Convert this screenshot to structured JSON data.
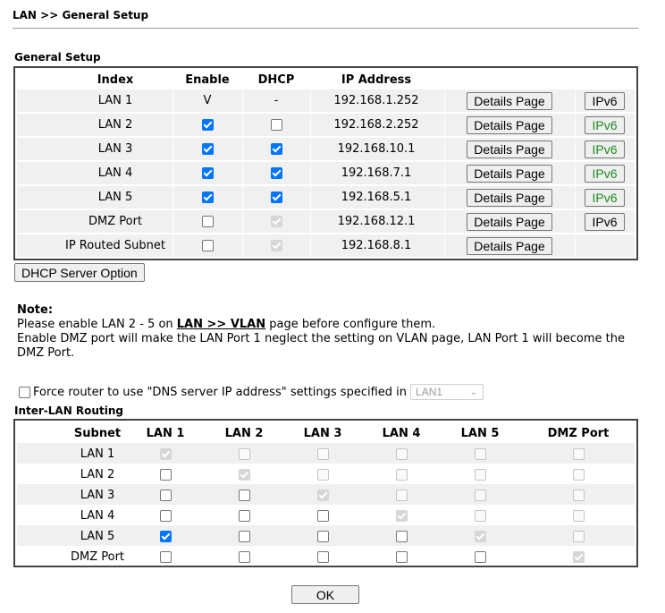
{
  "page": {
    "title": "LAN >> General Setup"
  },
  "general_setup": {
    "label": "General Setup",
    "columns": [
      "Index",
      "Enable",
      "DHCP",
      "IP Address"
    ],
    "rows": [
      {
        "index": "LAN 1",
        "enable": "V",
        "dhcp": "-",
        "ip": "192.168.1.252",
        "details": "Details Page",
        "ipv6": "IPv6",
        "ipv6_green": false
      },
      {
        "index": "LAN 2",
        "enable": true,
        "dhcp": false,
        "ip": "192.168.2.252",
        "details": "Details Page",
        "ipv6": "IPv6",
        "ipv6_green": true
      },
      {
        "index": "LAN 3",
        "enable": true,
        "dhcp": true,
        "ip": "192.168.10.1",
        "details": "Details Page",
        "ipv6": "IPv6",
        "ipv6_green": true
      },
      {
        "index": "LAN 4",
        "enable": true,
        "dhcp": true,
        "ip": "192.168.7.1",
        "details": "Details Page",
        "ipv6": "IPv6",
        "ipv6_green": true
      },
      {
        "index": "LAN 5",
        "enable": true,
        "dhcp": true,
        "ip": "192.168.5.1",
        "details": "Details Page",
        "ipv6": "IPv6",
        "ipv6_green": true
      },
      {
        "index": "DMZ Port",
        "enable": false,
        "dhcp": "disabled-checked",
        "ip": "192.168.12.1",
        "details": "Details Page",
        "ipv6": "IPv6",
        "ipv6_green": false
      },
      {
        "index": "IP Routed Subnet",
        "enable": false,
        "dhcp": "disabled-checked",
        "ip": "192.168.8.1",
        "details": "Details Page",
        "ipv6": "",
        "ipv6_green": false
      }
    ],
    "dhcp_server_option_label": "DHCP Server Option"
  },
  "note": {
    "heading": "Note:",
    "line1_pre": "Please enable LAN 2 - 5 on ",
    "line1_link": "LAN >> VLAN",
    "line1_post": " page before configure them.",
    "line2": "Enable DMZ port will make the LAN Port 1 neglect the setting on VLAN page, LAN Port 1 will become the DMZ Port."
  },
  "dns": {
    "label": "Force router to use \"DNS server IP address\" settings specified in",
    "checked": false,
    "select_value": "LAN1"
  },
  "inter_lan": {
    "label": "Inter-LAN Routing",
    "columns": [
      "Subnet",
      "LAN 1",
      "LAN 2",
      "LAN 3",
      "LAN 4",
      "LAN 5",
      "DMZ Port"
    ],
    "rows": [
      {
        "subnet": "LAN 1",
        "cells": [
          "dc",
          "d",
          "d",
          "d",
          "d",
          "d"
        ]
      },
      {
        "subnet": "LAN 2",
        "cells": [
          "u",
          "dc",
          "d",
          "d",
          "d",
          "d"
        ]
      },
      {
        "subnet": "LAN 3",
        "cells": [
          "u",
          "u",
          "dc",
          "d",
          "d",
          "d"
        ]
      },
      {
        "subnet": "LAN 4",
        "cells": [
          "u",
          "u",
          "u",
          "dc",
          "d",
          "d"
        ]
      },
      {
        "subnet": "LAN 5",
        "cells": [
          "c",
          "u",
          "u",
          "u",
          "dc",
          "d"
        ]
      },
      {
        "subnet": "DMZ Port",
        "cells": [
          "u",
          "u",
          "u",
          "u",
          "u",
          "dc"
        ]
      }
    ]
  },
  "ok_label": "OK"
}
